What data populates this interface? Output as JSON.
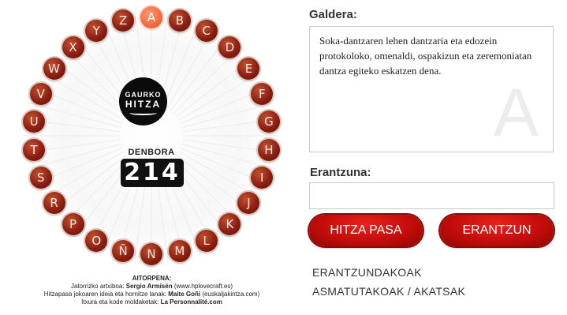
{
  "wheel": {
    "letters": [
      "A",
      "B",
      "C",
      "D",
      "E",
      "F",
      "G",
      "H",
      "I",
      "J",
      "K",
      "L",
      "M",
      "N",
      "Ñ",
      "O",
      "P",
      "R",
      "S",
      "T",
      "U",
      "V",
      "W",
      "X",
      "Y",
      "Z"
    ],
    "active_letter": "A",
    "colors": {
      "letter": "#8d1f12",
      "active": "#f26a3e"
    }
  },
  "logo": {
    "line1": "GAURKO",
    "line2": "HITZA"
  },
  "timer": {
    "label": "DENBORA",
    "value": "214"
  },
  "credits": {
    "title": "AITORPENA:",
    "line1_prefix": "Jatorrizko artxiboa: ",
    "line1_name": "Sergio Armisén",
    "line1_suffix": " (www.hplovecraft.es)",
    "line2_prefix": "Hitzapasa jokoaren ideia eta hornitze lanak: ",
    "line2_name": "Maite Goñi",
    "line2_suffix": " (euskaljakintza.com)",
    "line3_prefix": "Itxura eta kode moldaketak: ",
    "line3_name": "La Personnalité.com"
  },
  "question": {
    "label": "Galdera:",
    "text": "Soka-dantzaren lehen dantzaria eta edozein protokoloko, omenaldi, ospakizun eta zeremoniatan dantza egiteko eskatzen dena.",
    "letter": "A"
  },
  "answer": {
    "label": "Erantzuna:",
    "value": ""
  },
  "buttons": {
    "pass": "HITZA PASA",
    "answer": "ERANTZUN"
  },
  "links": {
    "answered": "ERANTZUNDAKOAK",
    "score": "ASMATUTAKOAK / AKATSAK"
  }
}
